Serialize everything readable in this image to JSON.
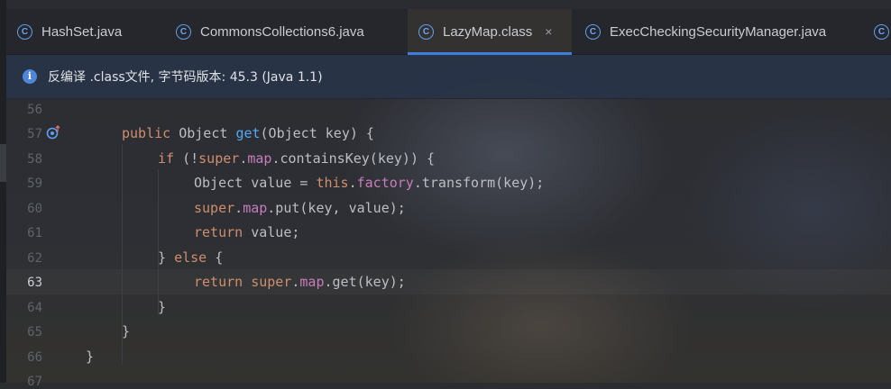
{
  "tabs": [
    {
      "label": "HashSet.java",
      "icon": "java-class-icon",
      "active": false
    },
    {
      "label": "CommonsCollections6.java",
      "icon": "java-class-icon",
      "active": false
    },
    {
      "label": "LazyMap.class",
      "icon": "java-class-icon",
      "active": true,
      "close": "×"
    },
    {
      "label": "ExecCheckingSecurityManager.java",
      "icon": "java-class-icon",
      "active": false
    }
  ],
  "banner": {
    "icon": "info-icon",
    "message": "反编译 .class文件, 字节码版本: 45.3 (Java 1.1)"
  },
  "editor": {
    "current_line": 63,
    "line_numbers": [
      "56",
      "57",
      "58",
      "59",
      "60",
      "61",
      "62",
      "63",
      "64",
      "65",
      "66",
      "67"
    ],
    "code": [
      "",
      "public Object get(Object key) {",
      "if (!super.map.containsKey(key)) {",
      "Object value = this.factory.transform(key);",
      "super.map.put(key, value);",
      "return value;",
      "} else {",
      "return super.map.get(key);",
      "}",
      "}",
      "}",
      ""
    ]
  },
  "colors": {
    "keyword": "#cf8e6d",
    "method": "#56a8f5",
    "field": "#c77dbb",
    "plain": "#bcbec4",
    "accent": "#3d7de0"
  }
}
